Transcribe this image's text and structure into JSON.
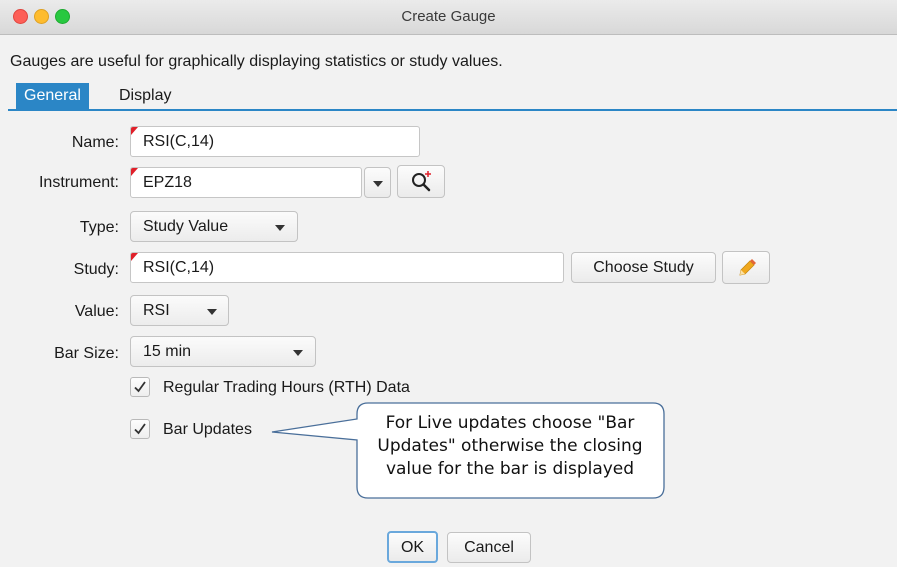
{
  "window": {
    "title": "Create Gauge"
  },
  "description": "Gauges are useful for graphically displaying statistics or study values.",
  "tabs": [
    {
      "label": "General",
      "active": true
    },
    {
      "label": "Display",
      "active": false
    }
  ],
  "form": {
    "name": {
      "label": "Name:",
      "value": "RSI(C,14)"
    },
    "instrument": {
      "label": "Instrument:",
      "value": "EPZ18",
      "search_icon": "search-plus-icon"
    },
    "type": {
      "label": "Type:",
      "value": "Study Value"
    },
    "study": {
      "label": "Study:",
      "value": "RSI(C,14)",
      "choose_label": "Choose Study",
      "edit_icon": "pencil-icon"
    },
    "value": {
      "label": "Value:",
      "value": "RSI"
    },
    "bar_size": {
      "label": "Bar Size:",
      "value": "15 min"
    },
    "rth": {
      "label": "Regular Trading Hours (RTH) Data",
      "checked": true
    },
    "bar_updates": {
      "label": "Bar Updates",
      "checked": true
    }
  },
  "callout": {
    "line1": "For Live updates choose \"Bar",
    "line2": "Updates\" otherwise the closing",
    "line3": "value for the bar is displayed"
  },
  "buttons": {
    "ok": "OK",
    "cancel": "Cancel"
  },
  "colors": {
    "accent": "#2b86c6",
    "required_marker": "#e0202a",
    "pencil": "#f0a81e"
  }
}
